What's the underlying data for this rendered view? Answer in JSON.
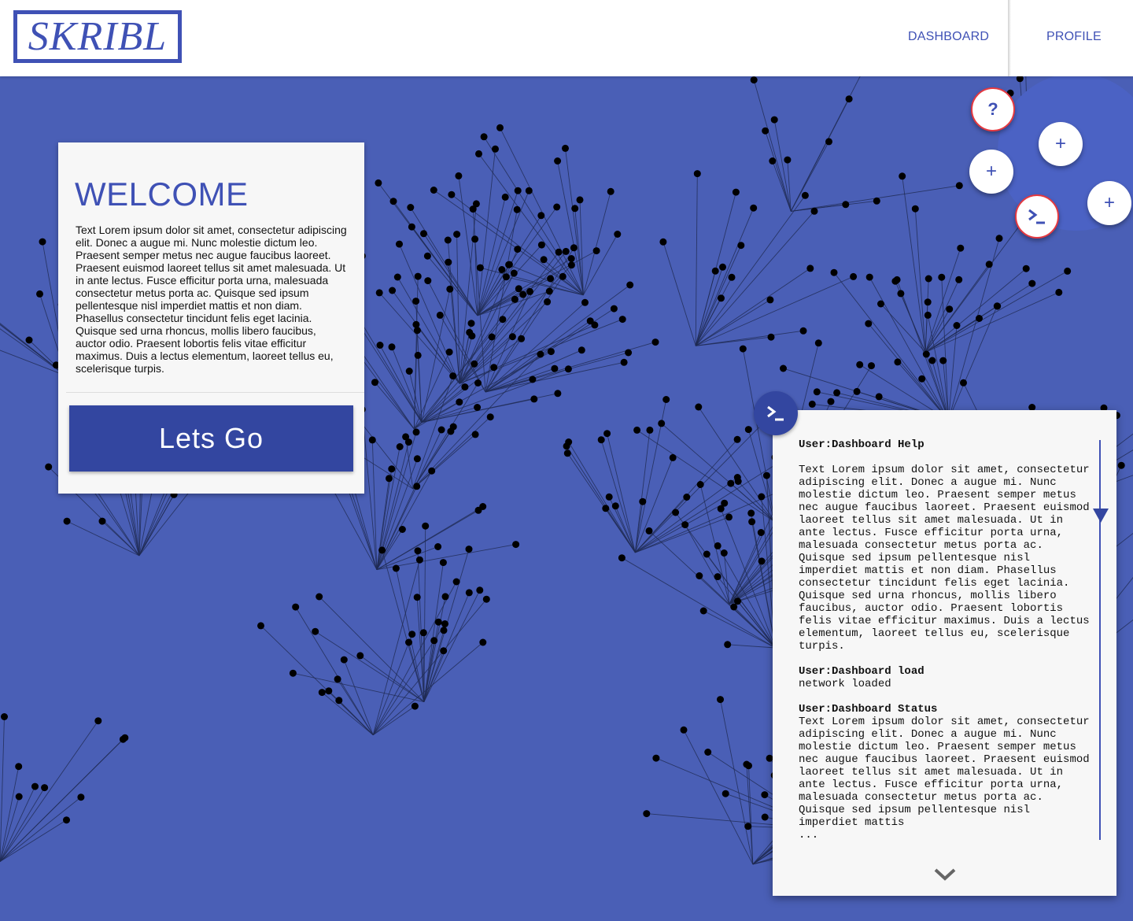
{
  "header": {
    "logo": "SKRIBL",
    "nav": {
      "dashboard": "DASHBOARD",
      "profile": "PROFILE"
    }
  },
  "fabs": {
    "help": "?",
    "add": "+",
    "terminal_icon": "terminal-icon"
  },
  "welcome": {
    "title": "WELCOME",
    "text": "Text Lorem ipsum dolor sit amet, consectetur adipiscing elit. Donec a augue mi. Nunc molestie dictum leo. Praesent semper metus nec augue faucibus laoreet. Praesent euismod laoreet tellus sit amet malesuada. Ut in ante lectus. Fusce efficitur porta urna, malesuada consectetur metus porta ac. Quisque sed ipsum pellentesque nisl imperdiet mattis et non diam. Phasellus consectetur tincidunt felis eget lacinia. Quisque sed urna rhoncus, mollis libero faucibus, auctor odio. Praesent lobortis felis vitae efficitur maximus. Duis a lectus elementum, laoreet tellus eu, scelerisque turpis.",
    "button": "Lets Go"
  },
  "console": {
    "entries": [
      {
        "title": "User:Dashboard Help",
        "body": "Text Lorem ipsum dolor sit amet, consectetur adipiscing elit. Donec a augue mi. Nunc molestie dictum leo. Praesent semper metus nec augue faucibus laoreet. Praesent euismod laoreet tellus sit amet malesuada. Ut in ante lectus. Fusce efficitur porta urna, malesuada consectetur metus porta ac. Quisque sed ipsum pellentesque nisl imperdiet mattis et non diam. Phasellus consectetur tincidunt felis eget lacinia. Quisque sed urna rhoncus, mollis libero faucibus, auctor odio. Praesent lobortis felis vitae efficitur maximus. Duis a lectus elementum, laoreet tellus eu, scelerisque turpis."
      },
      {
        "title": "User:Dashboard load",
        "body": "network loaded"
      },
      {
        "title": "User:Dashboard Status",
        "body": "Text Lorem ipsum dolor sit amet, consectetur adipiscing elit. Donec a augue mi. Nunc molestie dictum leo. Praesent semper metus nec augue faucibus laoreet. Praesent euismod laoreet tellus sit amet malesuada. Ut in ante lectus. Fusce efficitur porta urna, malesuada consectetur metus porta ac. Quisque sed ipsum pellentesque nisl imperdiet mattis",
        "ellipsis": "..."
      }
    ]
  },
  "colors": {
    "brand": "#3f51b5",
    "button": "#3346a0",
    "background": "#4a5fb6",
    "alert_ring": "#e53940",
    "node": "#000000"
  }
}
